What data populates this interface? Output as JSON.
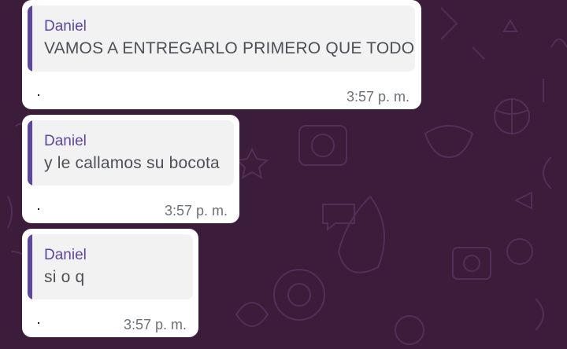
{
  "messages": [
    {
      "author": "Daniel",
      "quote_text": "VAMOS A ENTREGARLO PRIMERO QUE TODOS",
      "time": "3:57 p. m."
    },
    {
      "author": "Daniel",
      "quote_text": "y le callamos su bocota",
      "time": "3:57 p. m."
    },
    {
      "author": "Daniel",
      "quote_text": "si o q",
      "time": "3:57 p. m."
    }
  ],
  "colors": {
    "background": "#3b1d3b",
    "accent": "#5b45a6",
    "bubble": "#ffffff",
    "quote_background": "#f2f2f3"
  }
}
